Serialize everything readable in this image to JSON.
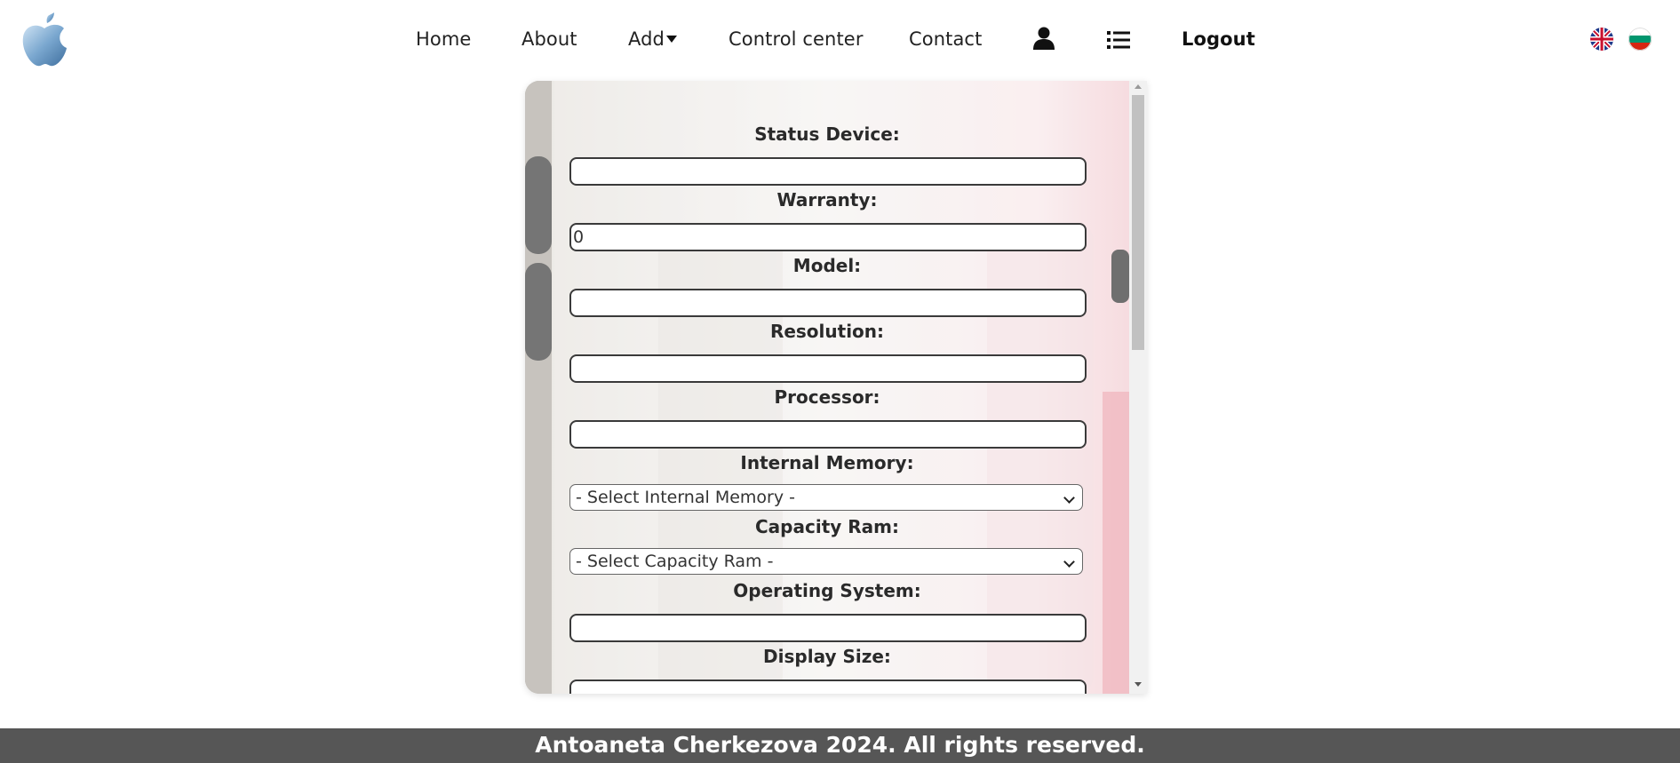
{
  "nav": {
    "home": "Home",
    "about": "About",
    "add": "Add",
    "control_center": "Control center",
    "contact": "Contact",
    "logout": "Logout"
  },
  "icons": {
    "logo": "apple-logo",
    "profile": "user-icon",
    "list": "list-icon",
    "lang_en": "uk-flag",
    "lang_bg": "bulgaria-flag"
  },
  "form": {
    "status_device": {
      "label": "Status Device:",
      "value": ""
    },
    "warranty": {
      "label": "Warranty:",
      "value": "0"
    },
    "model": {
      "label": "Model:",
      "value": ""
    },
    "resolution": {
      "label": "Resolution:",
      "value": ""
    },
    "processor": {
      "label": "Processor:",
      "value": ""
    },
    "internal_memory": {
      "label": "Internal Memory:",
      "selected": "- Select Internal Memory -"
    },
    "capacity_ram": {
      "label": "Capacity Ram:",
      "selected": "- Select Capacity Ram -"
    },
    "operating_system": {
      "label": "Operating System:",
      "value": ""
    },
    "display_size": {
      "label": "Display Size:",
      "value": ""
    }
  },
  "footer": {
    "text": "Antoaneta Cherkezova 2024. All rights reserved."
  },
  "colors": {
    "footer_bg": "#565656",
    "nav_text": "#222222"
  }
}
